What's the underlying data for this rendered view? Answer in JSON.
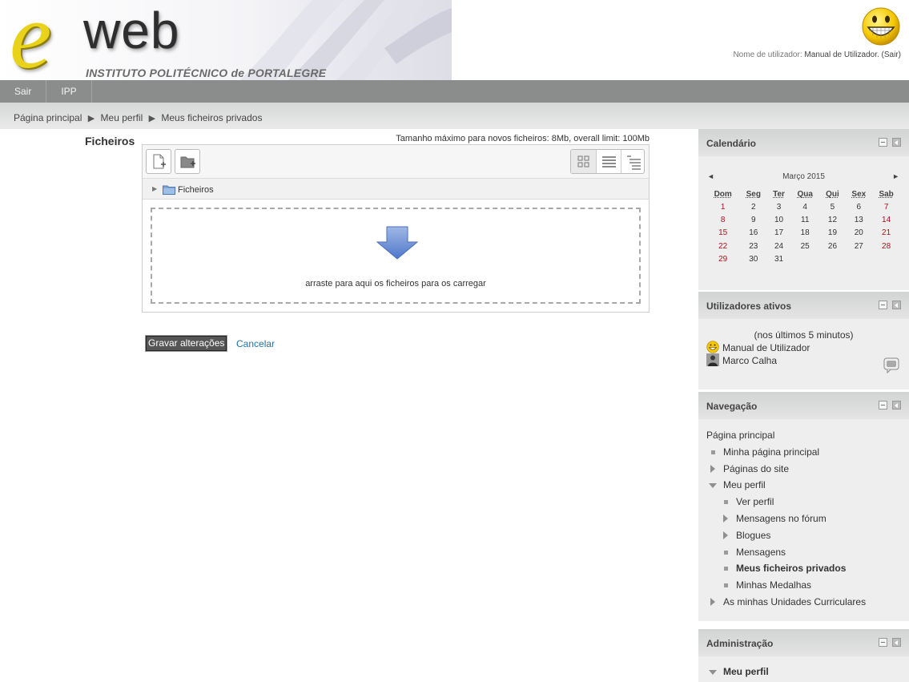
{
  "header": {
    "logo": {
      "letter": "e",
      "word": "web",
      "subtitle_upper": "INSTITUTO POLITÉCNICO ",
      "subtitle_lower": "de",
      "subtitle_end": " PORTALEGRE"
    },
    "login": {
      "prefix": "Nome de utilizador: ",
      "user": "Manual de Utilizador",
      "logout": ". (Sair)"
    }
  },
  "menubar": {
    "items": [
      "Sair",
      "IPP"
    ]
  },
  "breadcrumb": {
    "items": [
      "Página principal",
      "Meu perfil",
      "Meus ficheiros privados"
    ],
    "separator": "▶"
  },
  "main": {
    "files_label": "Ficheiros",
    "limit_text": "Tamanho máximo para novos ficheiros: 8Mb, overall limit: 100Mb",
    "path_label": "Ficheiros",
    "drop_text": "arraste para aqui os ficheiros para os carregar",
    "save_label": "Gravar alterações",
    "cancel_label": "Cancelar"
  },
  "calendar": {
    "title": "Calendário",
    "month": "Março 2015",
    "prev": "◄",
    "next": "►",
    "weekdays": [
      "Dom",
      "Seg",
      "Ter",
      "Qua",
      "Qui",
      "Sex",
      "Sab"
    ],
    "weeks": [
      [
        "1",
        "2",
        "3",
        "4",
        "5",
        "6",
        "7"
      ],
      [
        "8",
        "9",
        "10",
        "11",
        "12",
        "13",
        "14"
      ],
      [
        "15",
        "16",
        "17",
        "18",
        "19",
        "20",
        "21"
      ],
      [
        "22",
        "23",
        "24",
        "25",
        "26",
        "27",
        "28"
      ],
      [
        "29",
        "30",
        "31",
        "",
        "",
        "",
        ""
      ]
    ]
  },
  "active_users": {
    "title": "Utilizadores ativos",
    "note": "(nos últimos 5 minutos)",
    "users": [
      "Manual de Utilizador",
      "Marco Calha"
    ]
  },
  "navigation": {
    "title": "Navegação",
    "root": "Página principal",
    "items": [
      "Minha página principal",
      "Páginas do site",
      "Meu perfil",
      "Ver perfil",
      "Mensagens no fórum",
      "Blogues",
      "Mensagens",
      "Meus ficheiros privados",
      "Minhas Medalhas",
      "As minhas Unidades Curriculares"
    ]
  },
  "administration": {
    "title": "Administração",
    "items": [
      "Meu perfil"
    ]
  },
  "colors": {
    "weekend": "#b0111b",
    "link": "#1e73a8",
    "menubar": "#8b8d8d",
    "logo_yellow": "#e8d21a"
  }
}
